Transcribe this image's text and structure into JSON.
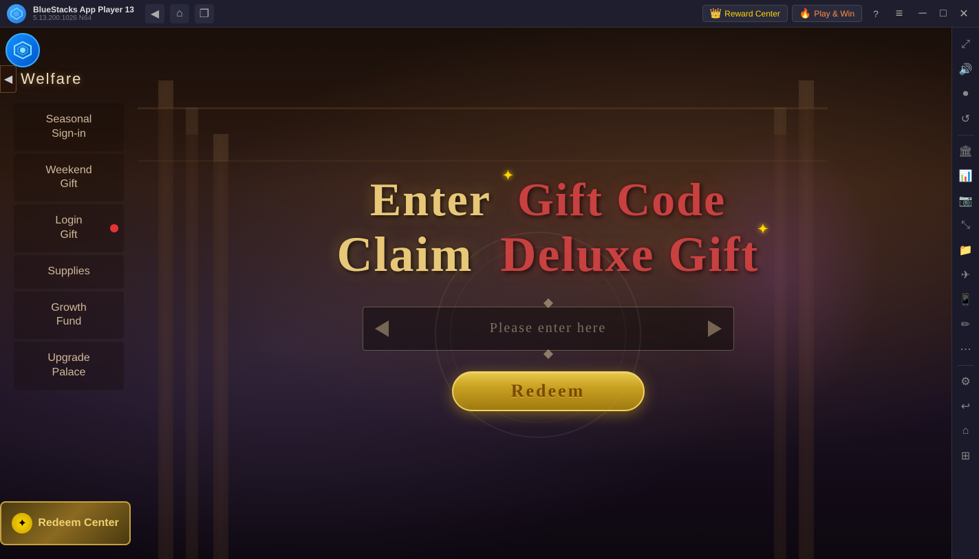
{
  "titlebar": {
    "app_name": "BlueStacks App Player 13",
    "version": "5.13.200.1026  N64",
    "reward_center_label": "Reward Center",
    "play_win_label": "Play & Win",
    "nav_back_icon": "◀",
    "nav_home_icon": "⌂",
    "nav_copy_icon": "❐",
    "menu_icon": "≡",
    "minimize_icon": "─",
    "maximize_icon": "□",
    "close_icon": "✕",
    "fullscreen_icon": "⤢"
  },
  "sidebar": {
    "welfare_label": "Welfare",
    "items": [
      {
        "label": "Seasonal\nSign-in",
        "has_badge": false
      },
      {
        "label": "Weekend\nGift",
        "has_badge": false
      },
      {
        "label": "Login\nGift",
        "has_badge": true
      },
      {
        "label": "Supplies",
        "has_badge": false
      },
      {
        "label": "Growth\nFund",
        "has_badge": false
      },
      {
        "label": "Upgrade\nPalace",
        "has_badge": false
      }
    ],
    "redeem_center_label": "Redeem\nCenter"
  },
  "main": {
    "title_line1_part1": "Enter ",
    "title_line1_part2": "Gift Code",
    "title_line2_part1": "Claim ",
    "title_line2_part2": "Deluxe Gift",
    "input_placeholder": "Please enter here",
    "redeem_button_label": "Redeem"
  },
  "right_sidebar": {
    "icons": [
      {
        "name": "fullscreen-icon",
        "symbol": "⤢"
      },
      {
        "name": "speaker-icon",
        "symbol": "🔊"
      },
      {
        "name": "record-icon",
        "symbol": "⏺"
      },
      {
        "name": "refresh-icon",
        "symbol": "↺"
      },
      {
        "name": "building-icon",
        "symbol": "🏛"
      },
      {
        "name": "chart-icon",
        "symbol": "📊"
      },
      {
        "name": "screenshot-icon",
        "symbol": "📷"
      },
      {
        "name": "resize-icon",
        "symbol": "⤡"
      },
      {
        "name": "folder-icon",
        "symbol": "📁"
      },
      {
        "name": "airplane-icon",
        "symbol": "✈"
      },
      {
        "name": "phone-icon",
        "symbol": "📱"
      },
      {
        "name": "brush-icon",
        "symbol": "✏"
      },
      {
        "name": "more-icon",
        "symbol": "⋯"
      },
      {
        "name": "settings-icon",
        "symbol": "⚙"
      },
      {
        "name": "back-icon",
        "symbol": "↩"
      },
      {
        "name": "home-icon",
        "symbol": "⌂"
      },
      {
        "name": "apps-icon",
        "symbol": "⊞"
      }
    ]
  }
}
